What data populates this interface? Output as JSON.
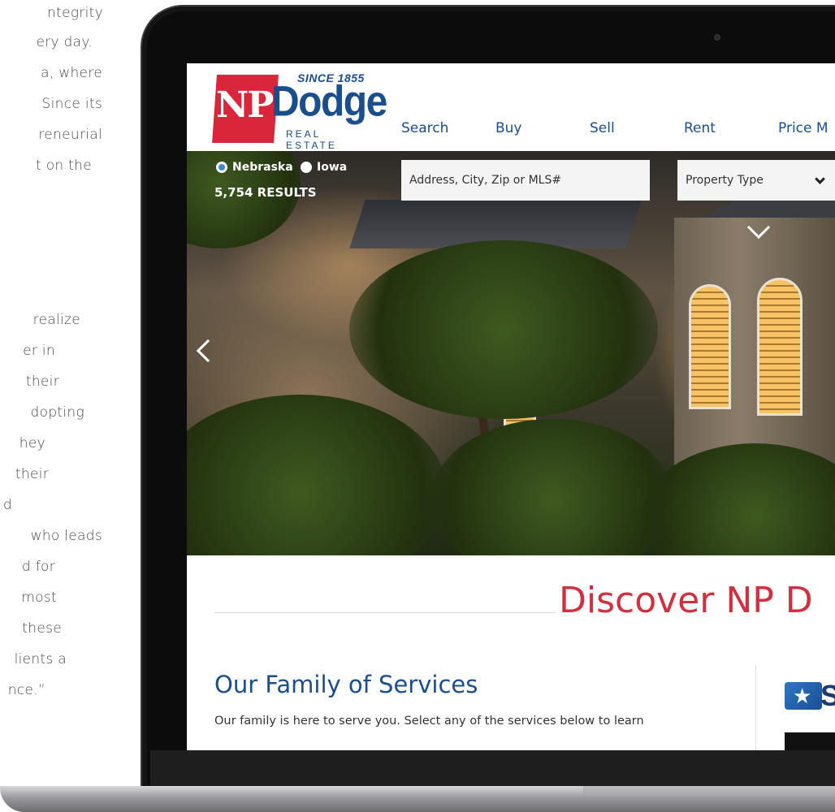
{
  "article": {
    "lines_top": [
      "ntegrity",
      "ery day.",
      "a, where",
      "Since its",
      "reneurial",
      "t on the"
    ],
    "lines_bottom": [
      "realize",
      "er in",
      "their",
      "dopting",
      "hey",
      "their",
      "d",
      "who leads",
      "d for",
      "most",
      "these",
      "lients a",
      "nce.”"
    ]
  },
  "logo": {
    "since": "SINCE 1855",
    "np": "NP",
    "dodge": "Dodge",
    "subtitle": "REAL ESTATE"
  },
  "nav": [
    "Search",
    "Buy",
    "Sell",
    "Rent",
    "Price M"
  ],
  "search": {
    "state_options": [
      "Nebraska",
      "Iowa"
    ],
    "selected_state": "Nebraska",
    "results": "5,754 RESULTS",
    "placeholder": "Address, City, Zip or MLS#",
    "property_type": "Property Type"
  },
  "content": {
    "discover": "Discover NP D",
    "services_title": "Our Family of Services",
    "services_desc": "Our family is here to serve you. Select any of the services below to learn",
    "partner_letter": "S"
  },
  "colors": {
    "brand_blue": "#1a4e8c",
    "brand_red": "#d0303f",
    "logo_red": "#d9263a"
  }
}
